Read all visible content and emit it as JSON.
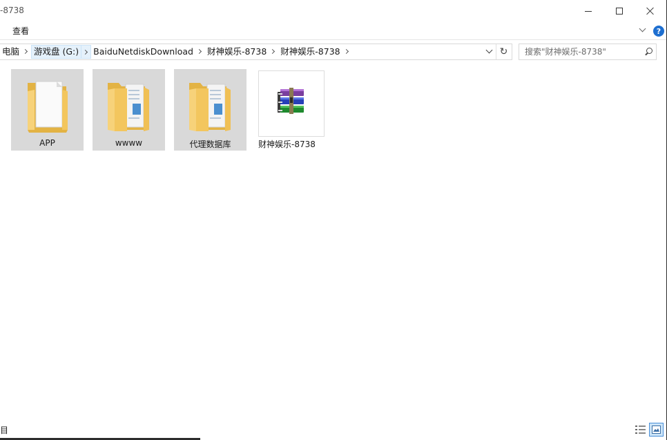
{
  "window": {
    "title": "-8738"
  },
  "ribbon": {
    "view_label": "查看",
    "help_label": "?"
  },
  "address": {
    "crumbs": [
      "电脑",
      "游戏盘 (G:)",
      "BaiduNetdiskDownload",
      "财神娱乐-8738",
      "财神娱乐-8738"
    ],
    "refresh_glyph": "↻"
  },
  "search": {
    "placeholder": "搜索\"财神娱乐-8738\""
  },
  "items": [
    {
      "label": "APP",
      "type": "folder-document",
      "selected": true
    },
    {
      "label": "wwww",
      "type": "folder-files",
      "selected": true
    },
    {
      "label": "代理数据库",
      "type": "folder-files",
      "selected": true
    },
    {
      "label": "财神娱乐-8738",
      "type": "winrar-archive",
      "selected": false
    }
  ],
  "status": {
    "text": "目"
  },
  "colors": {
    "selection": "#d9d9d9",
    "accent": "#1e6fd0",
    "folder": "#f4cc6a"
  },
  "icons": {
    "minimize": "minimize-icon",
    "maximize": "maximize-icon",
    "close": "close-icon",
    "search": "search-icon",
    "help": "help-icon",
    "refresh": "refresh-icon",
    "folder": "folder-icon",
    "archive": "winrar-archive-icon"
  }
}
